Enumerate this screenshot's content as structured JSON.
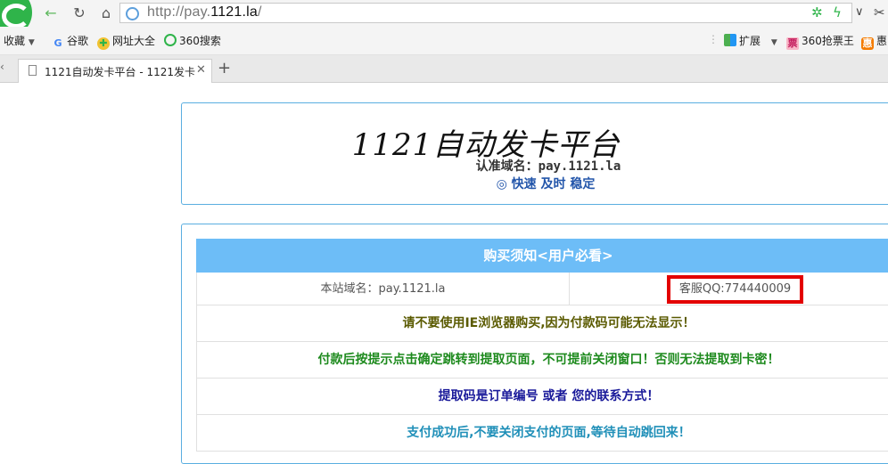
{
  "browser": {
    "url_prefix": "http://pay.",
    "url_host": "1121.la",
    "url_suffix": "/",
    "bookmarks": {
      "favorites": "收藏",
      "google": "谷歌",
      "nav_site": "网址大全",
      "search360": "360搜索",
      "extensions": "扩展",
      "ticket": "360抢票王",
      "hui": "惠"
    },
    "tab_title": "1121自动发卡平台   -   1121发卡",
    "colors": {
      "accent_green": "#2fb44a",
      "chrome_bg": "#f4f4f4"
    }
  },
  "header": {
    "site_title": "1121自动发卡平台",
    "verified_domain": "认准域名：pay.1121.la",
    "slogan": "◎ 快速 及时 稳定"
  },
  "notice": {
    "heading": "购买须知<用户必看>",
    "site_domain": "本站域名：pay.1121.la",
    "service_qq": "客服QQ:774440009",
    "lines": [
      {
        "text": "请不要使用IE浏览器购买,因为付款码可能无法显示！",
        "color": "#5a5a00"
      },
      {
        "text": "付款后按提示点击确定跳转到提取页面，不可提前关闭窗口！否则无法提取到卡密！",
        "color": "#1d8a1d"
      },
      {
        "text": "提取码是订单编号 或者 您的联系方式！",
        "color": "#1a1a9a"
      },
      {
        "text": "支付成功后,不要关闭支付的页面,等待自动跳回来！",
        "color": "#1f8fb8"
      }
    ],
    "colors": {
      "header_bg": "#6dbdf7",
      "border": "#5aaee0",
      "highlight": "#e30000"
    }
  }
}
